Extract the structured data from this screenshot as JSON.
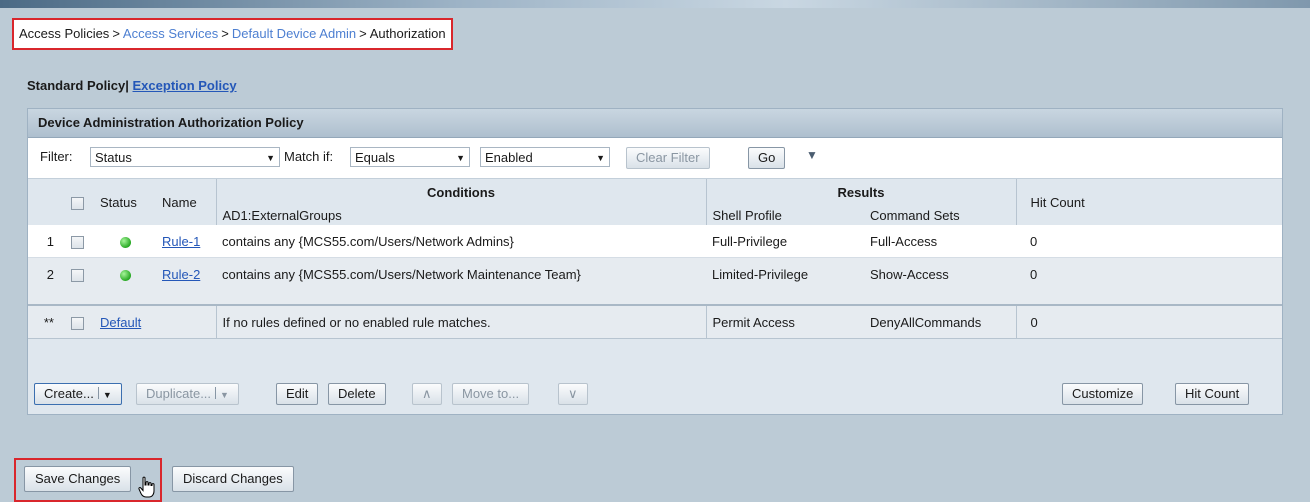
{
  "breadcrumb": {
    "items": [
      "Access Policies",
      "Access Services",
      "Default Device Admin",
      "Authorization"
    ],
    "separator": ">"
  },
  "policy_tabs": {
    "standard": "Standard Policy",
    "separator": "|",
    "exception": "Exception Policy"
  },
  "panel": {
    "title": "Device Administration Authorization Policy"
  },
  "filter": {
    "label": "Filter:",
    "field_value": "Status",
    "match_label": "Match if:",
    "match_value": "Equals",
    "state_value": "Enabled",
    "clear_label": "Clear Filter",
    "go_label": "Go"
  },
  "table": {
    "headers": {
      "status": "Status",
      "name": "Name",
      "conditions": "Conditions",
      "conditions_sub": "AD1:ExternalGroups",
      "results": "Results",
      "shell_profile": "Shell Profile",
      "command_sets": "Command Sets",
      "hit_count": "Hit Count"
    },
    "rows": [
      {
        "num": "1",
        "name": "Rule-1",
        "condition": "contains any {MCS55.com/Users/Network Admins}",
        "shell": "Full-Privilege",
        "commands": "Full-Access",
        "hits": "0"
      },
      {
        "num": "2",
        "name": "Rule-2",
        "condition": "contains any {MCS55.com/Users/Network Maintenance Team}",
        "shell": "Limited-Privilege",
        "commands": "Show-Access",
        "hits": "0"
      }
    ],
    "default_row": {
      "num": "**",
      "name": "Default",
      "condition": "If no rules defined or no enabled rule matches.",
      "shell": "Permit Access",
      "commands": "DenyAllCommands",
      "hits": "0"
    }
  },
  "actions": {
    "create": "Create...",
    "duplicate": "Duplicate...",
    "edit": "Edit",
    "delete": "Delete",
    "move_to": "Move to...",
    "customize": "Customize",
    "hit_count": "Hit Count"
  },
  "buttons": {
    "save": "Save Changes",
    "discard": "Discard Changes"
  },
  "colors": {
    "highlight": "#d9262c",
    "link": "#2457b8",
    "status_enabled": "#27a823"
  }
}
